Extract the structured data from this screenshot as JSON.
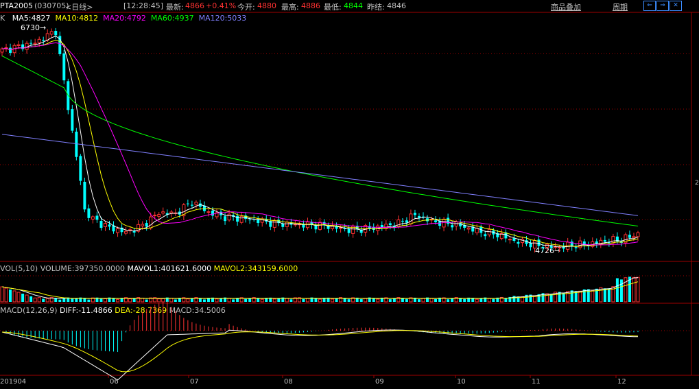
{
  "header": {
    "symbol": "PTA2005",
    "code": "(030705)",
    "period": "<日线>",
    "time": "[12:28:45]",
    "latest_label": "最新:",
    "latest_value": "4866",
    "change_pct": "+0.41%",
    "open_label": "今开:",
    "open_value": "4880",
    "high_label": "最高:",
    "high_value": "4886",
    "low_label": "最低:",
    "low_value": "4844",
    "prev_label": "昨结:",
    "prev_value": "4846",
    "overlay_link": "商品叠加",
    "cycle_link": "周期",
    "nav_left": "⇐",
    "nav_right": "⇒",
    "nav_x": "✕"
  },
  "ma_legend": {
    "prefix": "K",
    "ma5": "MA5:4827",
    "ma10": "MA10:4812",
    "ma20": "MA20:4792",
    "ma60": "MA60:4937",
    "ma120": "MA120:5033"
  },
  "annotations": {
    "high_marker": "6730→",
    "low_marker": "4726→"
  },
  "vol_legend": {
    "label": "VOL(5,10)",
    "volume": "VOLUME:397350.0000",
    "mavol1": "MAVOL1:401621.6000",
    "mavol2": "MAVOL2:343159.6000"
  },
  "macd_legend": {
    "label": "MACD(12,26,9)",
    "diff": "DIFF:-11.4866",
    "dea": "DEA:-28.7369",
    "macd": "MACD:34.5006"
  },
  "x_axis": {
    "labels": [
      "201904",
      "06",
      "07",
      "08",
      "09",
      "10",
      "11",
      "12"
    ]
  },
  "right_axis_fragment": "2",
  "colors": {
    "up": "#ff3232",
    "down": "#00ffff",
    "ma5": "#ffffff",
    "ma10": "#ffff00",
    "ma20": "#ff00ff",
    "ma60": "#00ff00",
    "ma120": "#8080ff",
    "grid": "#a00000"
  },
  "chart_data": {
    "type": "candlestick",
    "price_series": {
      "name": "PTA2005",
      "dates": [
        "201904",
        "06",
        "07",
        "08",
        "09",
        "10",
        "11",
        "12"
      ],
      "key_points": [
        {
          "label": "high",
          "value": 6730
        },
        {
          "label": "low",
          "value": 4726
        },
        {
          "label": "latest",
          "value": 4866
        }
      ]
    },
    "moving_averages": [
      {
        "name": "MA5",
        "value": 4827
      },
      {
        "name": "MA10",
        "value": 4812
      },
      {
        "name": "MA20",
        "value": 4792
      },
      {
        "name": "MA60",
        "value": 4937
      },
      {
        "name": "MA120",
        "value": 5033
      }
    ],
    "volume": {
      "VOLUME": 397350.0,
      "MAVOL1": 401621.6,
      "MAVOL2": 343159.6
    },
    "macd": {
      "DIFF": -11.4866,
      "DEA": -28.7369,
      "MACD": 34.5006
    }
  }
}
